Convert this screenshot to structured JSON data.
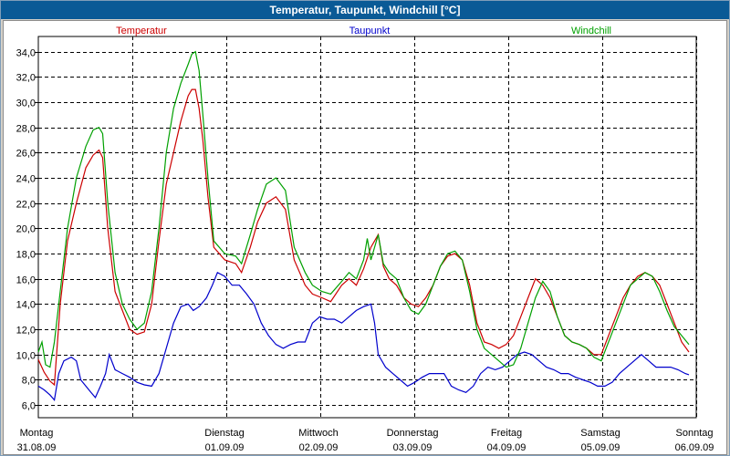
{
  "window": {
    "title": "Temperatur, Taupunkt, Windchill [°C]"
  },
  "colors": {
    "temperatur": "#cc0000",
    "taupunkt": "#0000cc",
    "windchill": "#00a000",
    "grid": "#000000",
    "titlebar": "#0a5a96"
  },
  "chart_data": {
    "type": "line",
    "title": "Temperatur, Taupunkt, Windchill [°C]",
    "xlabel": "",
    "ylabel": "",
    "grid": true,
    "legend_position": "top",
    "ylim": [
      5.0,
      35.2
    ],
    "xlim": [
      0,
      7
    ],
    "yticks": [
      "6,0",
      "8,0",
      "10,0",
      "12,0",
      "14,0",
      "16,0",
      "18,0",
      "20,0",
      "22,0",
      "24,0",
      "26,0",
      "28,0",
      "30,0",
      "32,0",
      "34,0"
    ],
    "ytick_values": [
      6,
      8,
      10,
      12,
      14,
      16,
      18,
      20,
      22,
      24,
      26,
      28,
      30,
      32,
      34
    ],
    "xticks": [
      {
        "day": "Montag",
        "date": "31.08.09"
      },
      {
        "day": "Dienstag",
        "date": "01.09.09"
      },
      {
        "day": "Mittwoch",
        "date": "02.09.09"
      },
      {
        "day": "Donnerstag",
        "date": "03.09.09"
      },
      {
        "day": "Freitag",
        "date": "04.09.09"
      },
      {
        "day": "Samstag",
        "date": "05.09.09"
      },
      {
        "day": "Sonntag",
        "date": "06.09.09"
      }
    ],
    "series": [
      {
        "name": "Temperatur",
        "color": "#cc0000",
        "points": [
          [
            0.0,
            9.6
          ],
          [
            0.08,
            8.6
          ],
          [
            0.16,
            7.9
          ],
          [
            0.22,
            7.6
          ],
          [
            0.3,
            14.0
          ],
          [
            0.4,
            19.0
          ],
          [
            0.52,
            22.0
          ],
          [
            0.65,
            24.8
          ],
          [
            0.75,
            25.8
          ],
          [
            0.83,
            26.2
          ],
          [
            0.88,
            25.6
          ],
          [
            0.95,
            20.0
          ],
          [
            1.05,
            15.0
          ],
          [
            1.15,
            13.5
          ],
          [
            1.25,
            12.0
          ],
          [
            1.35,
            11.6
          ],
          [
            1.45,
            11.8
          ],
          [
            1.55,
            14.0
          ],
          [
            1.65,
            19.0
          ],
          [
            1.75,
            23.5
          ],
          [
            1.85,
            26.0
          ],
          [
            1.95,
            28.5
          ],
          [
            2.05,
            30.5
          ],
          [
            2.1,
            31.0
          ],
          [
            2.15,
            31.0
          ],
          [
            2.2,
            29.5
          ],
          [
            2.25,
            27.0
          ],
          [
            2.32,
            22.5
          ],
          [
            2.4,
            18.5
          ],
          [
            2.55,
            17.5
          ],
          [
            2.7,
            17.2
          ],
          [
            2.78,
            16.5
          ],
          [
            2.9,
            18.5
          ],
          [
            3.0,
            20.5
          ],
          [
            3.12,
            22.0
          ],
          [
            3.25,
            22.5
          ],
          [
            3.38,
            21.5
          ],
          [
            3.5,
            17.5
          ],
          [
            3.65,
            15.5
          ],
          [
            3.75,
            14.8
          ],
          [
            3.88,
            14.5
          ],
          [
            4.0,
            14.2
          ],
          [
            4.15,
            15.5
          ],
          [
            4.25,
            16.0
          ],
          [
            4.35,
            15.5
          ],
          [
            4.45,
            16.8
          ],
          [
            4.55,
            18.5
          ],
          [
            4.65,
            19.5
          ],
          [
            4.72,
            17.0
          ],
          [
            4.8,
            16.0
          ],
          [
            4.9,
            15.5
          ],
          [
            5.0,
            14.5
          ],
          [
            5.1,
            14.0
          ],
          [
            5.2,
            13.8
          ],
          [
            5.3,
            14.5
          ],
          [
            5.4,
            15.5
          ],
          [
            5.5,
            17.0
          ],
          [
            5.6,
            17.8
          ],
          [
            5.7,
            18.0
          ],
          [
            5.8,
            17.5
          ],
          [
            5.9,
            15.5
          ],
          [
            6.0,
            12.5
          ],
          [
            6.1,
            11.0
          ],
          [
            6.2,
            10.8
          ],
          [
            6.3,
            10.5
          ],
          [
            6.4,
            10.8
          ],
          [
            6.5,
            11.5
          ],
          [
            6.6,
            13.0
          ],
          [
            6.7,
            14.5
          ],
          [
            6.8,
            16.0
          ],
          [
            6.9,
            15.5
          ],
          [
            7.0,
            14.5
          ],
          [
            7.1,
            13.0
          ],
          [
            7.2,
            11.5
          ],
          [
            7.3,
            11.0
          ],
          [
            7.4,
            10.8
          ],
          [
            7.5,
            10.5
          ],
          [
            7.6,
            10.0
          ],
          [
            7.7,
            10.0
          ],
          [
            7.8,
            11.5
          ],
          [
            7.9,
            13.0
          ],
          [
            8.0,
            14.5
          ],
          [
            8.1,
            15.5
          ],
          [
            8.2,
            16.2
          ],
          [
            8.3,
            16.5
          ],
          [
            8.4,
            16.2
          ],
          [
            8.5,
            15.5
          ],
          [
            8.6,
            14.0
          ],
          [
            8.7,
            12.5
          ],
          [
            8.8,
            11.0
          ],
          [
            8.9,
            10.2
          ]
        ]
      },
      {
        "name": "Taupunkt",
        "color": "#0000cc",
        "points": [
          [
            0.0,
            7.5
          ],
          [
            0.08,
            7.2
          ],
          [
            0.16,
            6.8
          ],
          [
            0.22,
            6.4
          ],
          [
            0.28,
            8.5
          ],
          [
            0.35,
            9.5
          ],
          [
            0.45,
            9.8
          ],
          [
            0.52,
            9.5
          ],
          [
            0.58,
            8.0
          ],
          [
            0.65,
            7.5
          ],
          [
            0.72,
            7.0
          ],
          [
            0.78,
            6.6
          ],
          [
            0.85,
            7.5
          ],
          [
            0.92,
            8.5
          ],
          [
            0.97,
            10.0
          ],
          [
            1.05,
            8.8
          ],
          [
            1.15,
            8.5
          ],
          [
            1.25,
            8.2
          ],
          [
            1.35,
            7.8
          ],
          [
            1.45,
            7.6
          ],
          [
            1.55,
            7.5
          ],
          [
            1.65,
            8.5
          ],
          [
            1.75,
            10.5
          ],
          [
            1.85,
            12.5
          ],
          [
            1.95,
            13.8
          ],
          [
            2.05,
            14.0
          ],
          [
            2.12,
            13.5
          ],
          [
            2.2,
            13.8
          ],
          [
            2.3,
            14.5
          ],
          [
            2.38,
            15.5
          ],
          [
            2.45,
            16.5
          ],
          [
            2.55,
            16.2
          ],
          [
            2.65,
            15.5
          ],
          [
            2.75,
            15.5
          ],
          [
            2.85,
            14.8
          ],
          [
            2.95,
            14.0
          ],
          [
            3.05,
            12.5
          ],
          [
            3.15,
            11.5
          ],
          [
            3.25,
            10.8
          ],
          [
            3.35,
            10.5
          ],
          [
            3.45,
            10.8
          ],
          [
            3.55,
            11.0
          ],
          [
            3.65,
            11.0
          ],
          [
            3.75,
            12.5
          ],
          [
            3.85,
            13.0
          ],
          [
            3.95,
            12.8
          ],
          [
            4.05,
            12.8
          ],
          [
            4.15,
            12.5
          ],
          [
            4.25,
            13.0
          ],
          [
            4.35,
            13.5
          ],
          [
            4.45,
            13.8
          ],
          [
            4.55,
            14.0
          ],
          [
            4.6,
            12.5
          ],
          [
            4.65,
            10.0
          ],
          [
            4.75,
            9.0
          ],
          [
            4.85,
            8.5
          ],
          [
            4.95,
            8.0
          ],
          [
            5.05,
            7.5
          ],
          [
            5.15,
            7.8
          ],
          [
            5.25,
            8.2
          ],
          [
            5.35,
            8.5
          ],
          [
            5.45,
            8.5
          ],
          [
            5.55,
            8.5
          ],
          [
            5.65,
            7.5
          ],
          [
            5.75,
            7.2
          ],
          [
            5.85,
            7.0
          ],
          [
            5.95,
            7.5
          ],
          [
            6.05,
            8.5
          ],
          [
            6.15,
            9.0
          ],
          [
            6.25,
            8.8
          ],
          [
            6.35,
            9.0
          ],
          [
            6.45,
            9.5
          ],
          [
            6.55,
            10.0
          ],
          [
            6.65,
            10.2
          ],
          [
            6.75,
            10.0
          ],
          [
            6.85,
            9.5
          ],
          [
            6.95,
            9.0
          ],
          [
            7.05,
            8.8
          ],
          [
            7.15,
            8.5
          ],
          [
            7.25,
            8.5
          ],
          [
            7.35,
            8.2
          ],
          [
            7.45,
            8.0
          ],
          [
            7.55,
            7.8
          ],
          [
            7.65,
            7.5
          ],
          [
            7.75,
            7.5
          ],
          [
            7.85,
            7.8
          ],
          [
            7.95,
            8.5
          ],
          [
            8.05,
            9.0
          ],
          [
            8.15,
            9.5
          ],
          [
            8.25,
            10.0
          ],
          [
            8.35,
            9.5
          ],
          [
            8.45,
            9.0
          ],
          [
            8.55,
            9.0
          ],
          [
            8.65,
            9.0
          ],
          [
            8.75,
            8.8
          ],
          [
            8.85,
            8.5
          ],
          [
            8.9,
            8.4
          ]
        ]
      },
      {
        "name": "Windchill",
        "color": "#00a000",
        "points": [
          [
            0.0,
            10.2
          ],
          [
            0.05,
            11.0
          ],
          [
            0.1,
            9.2
          ],
          [
            0.16,
            9.0
          ],
          [
            0.22,
            11.0
          ],
          [
            0.3,
            15.0
          ],
          [
            0.4,
            20.0
          ],
          [
            0.52,
            24.0
          ],
          [
            0.65,
            26.5
          ],
          [
            0.75,
            27.8
          ],
          [
            0.83,
            28.0
          ],
          [
            0.88,
            27.5
          ],
          [
            0.95,
            22.0
          ],
          [
            1.05,
            16.5
          ],
          [
            1.15,
            14.0
          ],
          [
            1.25,
            12.8
          ],
          [
            1.35,
            12.0
          ],
          [
            1.45,
            12.5
          ],
          [
            1.55,
            15.0
          ],
          [
            1.65,
            20.0
          ],
          [
            1.75,
            26.0
          ],
          [
            1.85,
            29.5
          ],
          [
            1.95,
            31.5
          ],
          [
            2.05,
            33.0
          ],
          [
            2.1,
            33.8
          ],
          [
            2.15,
            34.0
          ],
          [
            2.2,
            32.5
          ],
          [
            2.25,
            29.0
          ],
          [
            2.32,
            24.0
          ],
          [
            2.4,
            19.0
          ],
          [
            2.55,
            18.0
          ],
          [
            2.7,
            17.8
          ],
          [
            2.78,
            17.2
          ],
          [
            2.9,
            19.5
          ],
          [
            3.0,
            21.5
          ],
          [
            3.12,
            23.5
          ],
          [
            3.25,
            24.0
          ],
          [
            3.38,
            23.0
          ],
          [
            3.5,
            18.5
          ],
          [
            3.65,
            16.5
          ],
          [
            3.75,
            15.5
          ],
          [
            3.88,
            15.0
          ],
          [
            4.0,
            14.8
          ],
          [
            4.15,
            15.8
          ],
          [
            4.25,
            16.5
          ],
          [
            4.35,
            16.0
          ],
          [
            4.45,
            17.5
          ],
          [
            4.5,
            19.2
          ],
          [
            4.55,
            17.5
          ],
          [
            4.65,
            19.5
          ],
          [
            4.72,
            17.2
          ],
          [
            4.8,
            16.5
          ],
          [
            4.9,
            16.0
          ],
          [
            5.0,
            14.5
          ],
          [
            5.1,
            13.5
          ],
          [
            5.2,
            13.2
          ],
          [
            5.3,
            14.0
          ],
          [
            5.4,
            15.5
          ],
          [
            5.5,
            17.0
          ],
          [
            5.6,
            18.0
          ],
          [
            5.7,
            18.2
          ],
          [
            5.8,
            17.5
          ],
          [
            5.9,
            15.0
          ],
          [
            6.0,
            12.0
          ],
          [
            6.1,
            10.5
          ],
          [
            6.2,
            10.0
          ],
          [
            6.3,
            9.5
          ],
          [
            6.4,
            9.0
          ],
          [
            6.5,
            9.2
          ],
          [
            6.6,
            10.5
          ],
          [
            6.7,
            12.5
          ],
          [
            6.8,
            14.5
          ],
          [
            6.9,
            15.8
          ],
          [
            7.0,
            15.0
          ],
          [
            7.1,
            13.0
          ],
          [
            7.2,
            11.5
          ],
          [
            7.3,
            11.0
          ],
          [
            7.4,
            10.8
          ],
          [
            7.5,
            10.5
          ],
          [
            7.6,
            9.8
          ],
          [
            7.7,
            9.5
          ],
          [
            7.8,
            11.0
          ],
          [
            7.9,
            12.5
          ],
          [
            8.0,
            14.0
          ],
          [
            8.1,
            15.5
          ],
          [
            8.2,
            16.0
          ],
          [
            8.3,
            16.5
          ],
          [
            8.4,
            16.2
          ],
          [
            8.5,
            15.0
          ],
          [
            8.6,
            13.5
          ],
          [
            8.7,
            12.2
          ],
          [
            8.8,
            11.5
          ],
          [
            8.9,
            10.8
          ]
        ]
      }
    ]
  }
}
